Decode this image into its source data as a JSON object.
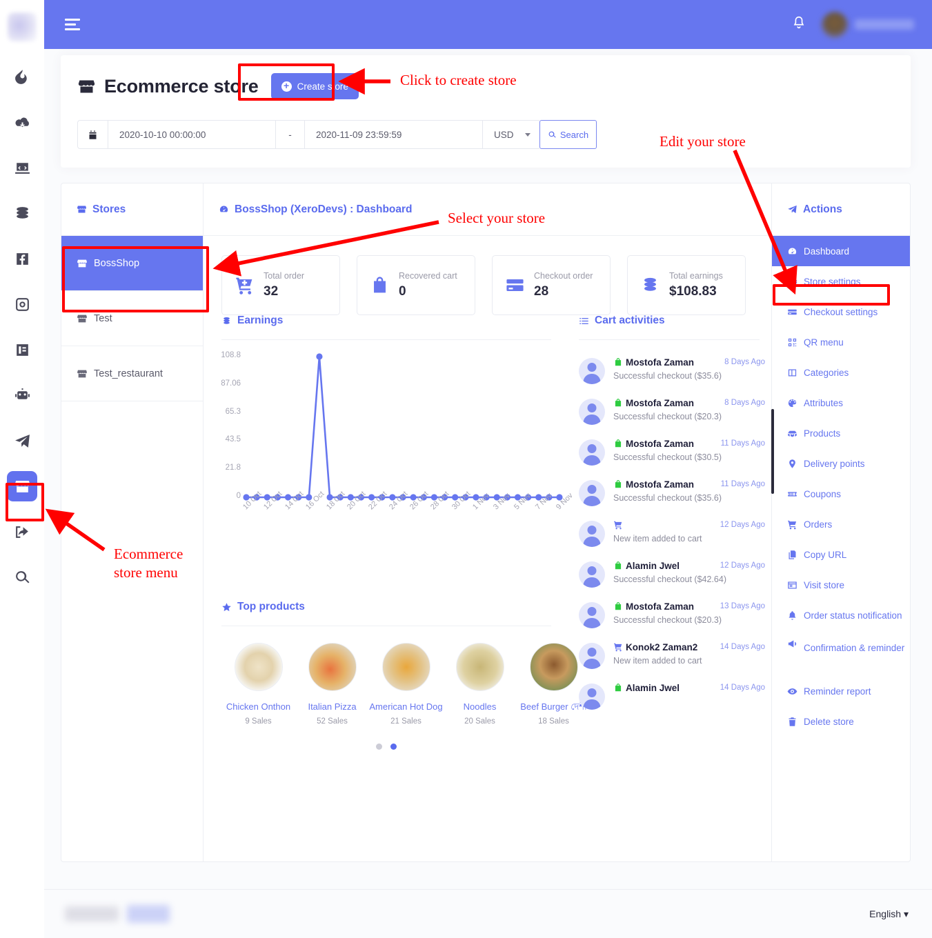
{
  "navbar": {
    "menu_icon": "hamburger-icon",
    "notification_icon": "bell-icon",
    "username": ""
  },
  "rail": {
    "items": [
      {
        "name": "fire-icon",
        "label": ""
      },
      {
        "name": "cloud-download-icon",
        "label": ""
      },
      {
        "name": "code-laptop-icon",
        "label": ""
      },
      {
        "name": "coins-icon",
        "label": ""
      },
      {
        "name": "facebook-icon",
        "label": ""
      },
      {
        "name": "instagram-icon",
        "label": ""
      },
      {
        "name": "contact-card-icon",
        "label": ""
      },
      {
        "name": "robot-icon",
        "label": ""
      },
      {
        "name": "telegram-send-icon",
        "label": ""
      },
      {
        "name": "store-icon",
        "label": ""
      },
      {
        "name": "share-export-icon",
        "label": ""
      },
      {
        "name": "search-icon",
        "label": ""
      }
    ]
  },
  "header": {
    "title": "Ecommerce store",
    "create_button": "Create store",
    "store_icon": "store-icon"
  },
  "filter": {
    "calendar_icon": "calendar-icon",
    "date_from": "2020-10-10 00:00:00",
    "separator": "-",
    "date_to": "2020-11-09 23:59:59",
    "currency": "USD",
    "search_label": "Search",
    "search_icon": "search-icon"
  },
  "stores_panel": {
    "title": "Stores",
    "icon": "store-icon",
    "items": [
      {
        "label": "BossShop",
        "active": true
      },
      {
        "label": "Test",
        "active": false
      },
      {
        "label": "Test_restaurant",
        "active": false
      }
    ]
  },
  "main": {
    "title": "BossShop (XeroDevs) : Dashboard",
    "title_icon": "dashboard-gauge-icon",
    "stats": [
      {
        "icon": "cart-plus-icon",
        "label": "Total order",
        "value": "32"
      },
      {
        "icon": "shopping-bag-icon",
        "label": "Recovered cart",
        "value": "0"
      },
      {
        "icon": "credit-card-icon",
        "label": "Checkout order",
        "value": "28"
      },
      {
        "icon": "coins-icon",
        "label": "Total earnings",
        "value": "$108.83"
      }
    ],
    "earnings_title": "Earnings",
    "earnings_icon": "coins-icon",
    "cart_title": "Cart activities",
    "cart_icon": "list-icon",
    "products_title": "Top products",
    "products_icon": "star-icon"
  },
  "chart_data": {
    "type": "line",
    "title": "Earnings",
    "xlabel": "",
    "ylabel": "",
    "ylim": [
      0,
      108.83
    ],
    "yticks": [
      "0",
      "21.8",
      "43.5",
      "65.3",
      "87.06",
      "108.8"
    ],
    "ytick_values": [
      0,
      21.8,
      43.5,
      65.3,
      87.06,
      108.8
    ],
    "grid": false,
    "legend": "none",
    "line_color": "#6676ef",
    "categories": [
      "10 Oct",
      "11 Oct",
      "12 Oct",
      "13 Oct",
      "14 Oct",
      "15 Oct",
      "16 Oct",
      "17 Oct",
      "18 Oct",
      "19 Oct",
      "20 Oct",
      "21 Oct",
      "22 Oct",
      "23 Oct",
      "24 Oct",
      "25 Oct",
      "26 Oct",
      "27 Oct",
      "28 Oct",
      "29 Oct",
      "30 Oct",
      "31 Oct",
      "1 Nov",
      "2 Nov",
      "3 Nov",
      "4 Nov",
      "5 Nov",
      "6 Nov",
      "7 Nov",
      "8 Nov",
      "9 Nov"
    ],
    "visible_xticks": [
      "10 Oct",
      "12 Oct",
      "14 Oct",
      "16 Oct",
      "18 Oct",
      "20 Oct",
      "22 Oct",
      "24 Oct",
      "26 Oct",
      "28 Oct",
      "30 Oct",
      "1 Nov",
      "3 Nov",
      "5 Nov",
      "7 Nov",
      "9 Nov"
    ],
    "values": [
      0,
      0,
      0,
      0,
      0,
      0,
      0,
      108.83,
      0,
      0,
      0,
      0,
      0,
      0,
      0,
      0,
      0,
      0,
      0,
      0,
      0,
      0,
      0,
      0,
      0,
      0,
      0,
      0,
      0,
      0,
      0
    ]
  },
  "cart_activities": [
    {
      "icon": "green-bag-icon",
      "name": "Mostofa Zaman",
      "time": "8 Days Ago",
      "desc": "Successful checkout ($35.6)"
    },
    {
      "icon": "green-bag-icon",
      "name": "Mostofa Zaman",
      "time": "8 Days Ago",
      "desc": "Successful checkout ($20.3)"
    },
    {
      "icon": "green-bag-icon",
      "name": "Mostofa Zaman",
      "time": "11 Days Ago",
      "desc": "Successful checkout ($30.5)"
    },
    {
      "icon": "green-bag-icon",
      "name": "Mostofa Zaman",
      "time": "11 Days Ago",
      "desc": "Successful checkout ($35.6)"
    },
    {
      "icon": "blue-cart-icon",
      "name": "",
      "time": "12 Days Ago",
      "desc": "New item added to cart"
    },
    {
      "icon": "green-bag-icon",
      "name": "Alamin Jwel",
      "time": "12 Days Ago",
      "desc": "Successful checkout ($42.64)"
    },
    {
      "icon": "green-bag-icon",
      "name": "Mostofa Zaman",
      "time": "13 Days Ago",
      "desc": "Successful checkout ($20.3)"
    },
    {
      "icon": "blue-cart-icon",
      "name": "Konok2 Zaman2",
      "time": "14 Days Ago",
      "desc": "New item added to cart"
    },
    {
      "icon": "green-bag-icon",
      "name": "Alamin Jwel",
      "time": "14 Days Ago",
      "desc": ""
    }
  ],
  "top_products": [
    {
      "name": "Chicken Onthon",
      "sales": "9 Sales",
      "image": "dumplings-photo"
    },
    {
      "name": "Italian Pizza",
      "sales": "52 Sales",
      "image": "pizza-photo"
    },
    {
      "name": "American Hot Dog",
      "sales": "21 Sales",
      "image": "hotdog-photo"
    },
    {
      "name": "Noodles",
      "sales": "20 Sales",
      "image": "noodles-photo"
    },
    {
      "name": "Beef Burger দেশী",
      "sales": "18 Sales",
      "image": "burger-photo"
    }
  ],
  "product_carousel": {
    "active_dot": 2,
    "dots": 2
  },
  "actions_panel": {
    "title": "Actions",
    "icon": "paper-plane-icon",
    "items": [
      {
        "label": "Dashboard",
        "icon": "dashboard-gauge-icon",
        "active": true
      },
      {
        "label": "Store settings",
        "icon": "gear-icon",
        "active": false
      },
      {
        "label": "Checkout settings",
        "icon": "card-lines-icon",
        "active": false
      },
      {
        "label": "QR menu",
        "icon": "qr-code-icon",
        "active": false
      },
      {
        "label": "Categories",
        "icon": "columns-icon",
        "active": false
      },
      {
        "label": "Attributes",
        "icon": "palette-icon",
        "active": false
      },
      {
        "label": "Products",
        "icon": "boxes-icon",
        "active": false
      },
      {
        "label": "Delivery points",
        "icon": "map-pin-icon",
        "active": false
      },
      {
        "label": "Coupons",
        "icon": "ticket-icon",
        "active": false
      },
      {
        "label": "Orders",
        "icon": "cart-icon",
        "active": false
      },
      {
        "label": "Copy URL",
        "icon": "copy-icon",
        "active": false
      },
      {
        "label": "Visit store",
        "icon": "window-icon",
        "active": false
      },
      {
        "label": "Order status notification",
        "icon": "bell-icon",
        "active": false
      },
      {
        "label": "Confirmation & reminder",
        "icon": "megaphone-icon",
        "active": false
      },
      {
        "label": "Reminder report",
        "icon": "eye-icon",
        "active": false
      },
      {
        "label": "Delete store",
        "icon": "trash-icon",
        "active": false
      }
    ]
  },
  "footer": {
    "language": "English"
  },
  "annotations": {
    "color": "#ff0000",
    "create_store": "Click to create store",
    "select_store": "Select your store",
    "edit_store": "Edit your store",
    "ecommerce_menu": "Ecommerce\nstore menu"
  }
}
